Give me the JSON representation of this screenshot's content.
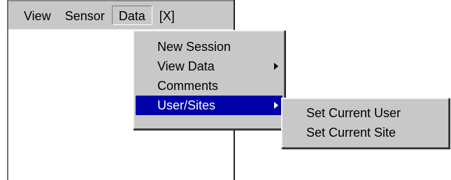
{
  "menubar": {
    "items": [
      {
        "label": "View"
      },
      {
        "label": "Sensor"
      },
      {
        "label": "Data"
      },
      {
        "label": "[X]"
      }
    ],
    "active_item": "Data"
  },
  "data_menu": {
    "items": [
      {
        "label": "New Session",
        "has_submenu": false
      },
      {
        "label": "View Data",
        "has_submenu": true
      },
      {
        "label": "Comments",
        "has_submenu": false
      },
      {
        "label": "User/Sites",
        "has_submenu": true,
        "highlighted": true
      }
    ]
  },
  "user_sites_submenu": {
    "items": [
      {
        "label": "Set Current User"
      },
      {
        "label": "Set Current Site"
      }
    ]
  },
  "colors": {
    "menu_face": "#c8c8c8",
    "highlight": "#0000a8",
    "highlight_text": "#ffffff"
  }
}
